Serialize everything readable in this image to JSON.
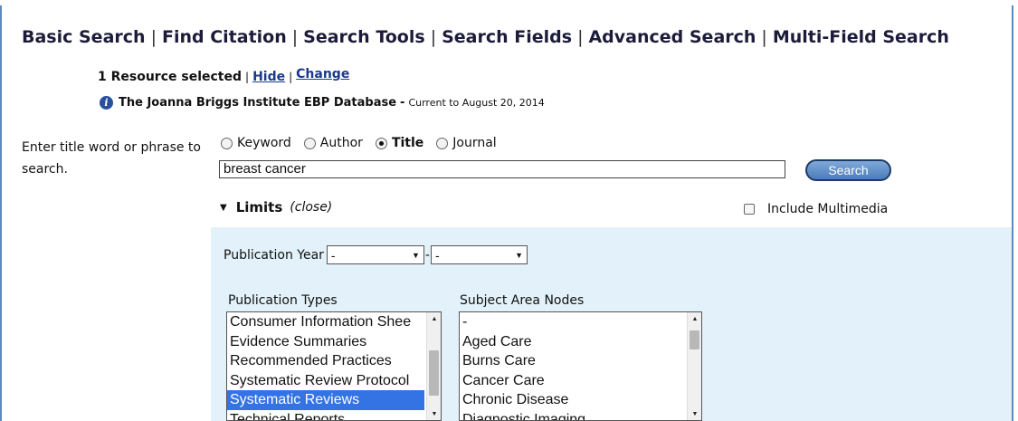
{
  "nav": {
    "items": [
      "Basic Search",
      "Find Citation",
      "Search Tools",
      "Search Fields",
      "Advanced Search",
      "Multi-Field Search"
    ],
    "separator": "|"
  },
  "resources": {
    "selected_text": "1 Resource selected",
    "pipe": "|",
    "hide_label": "Hide",
    "change_label": "Change",
    "database_name": "The Joanna Briggs Institute EBP Database",
    "dash": "-",
    "current_text": "Current to August 20, 2014"
  },
  "search": {
    "prompt": "Enter title word or phrase to search.",
    "field_options": [
      {
        "label": "Keyword",
        "checked": false
      },
      {
        "label": "Author",
        "checked": false
      },
      {
        "label": "Title",
        "checked": true
      },
      {
        "label": "Journal",
        "checked": false
      }
    ],
    "query": "breast cancer",
    "button_label": "Search"
  },
  "limits": {
    "label": "Limits",
    "close_label": "(close)",
    "include_multimedia_label": "Include Multimedia",
    "include_multimedia_checked": false,
    "publication_year_label": "Publication Year",
    "year_from": "-",
    "year_to": "-",
    "year_separator": "-",
    "publication_types_label": "Publication Types",
    "publication_types": [
      {
        "label": "Consumer Information Shee",
        "selected": false
      },
      {
        "label": "Evidence Summaries",
        "selected": false
      },
      {
        "label": "Recommended Practices",
        "selected": false
      },
      {
        "label": "Systematic Review Protocol",
        "selected": false
      },
      {
        "label": "Systematic Reviews",
        "selected": true
      },
      {
        "label": "Technical Reports",
        "selected": false
      }
    ],
    "subject_area_label": "Subject Area Nodes",
    "subject_areas": [
      {
        "label": "-",
        "selected": false
      },
      {
        "label": "Aged Care",
        "selected": false
      },
      {
        "label": "Burns Care",
        "selected": false
      },
      {
        "label": "Cancer Care",
        "selected": false
      },
      {
        "label": "Chronic Disease",
        "selected": false
      },
      {
        "label": "Diagnostic Imaging",
        "selected": false
      }
    ]
  },
  "colors": {
    "accent": "#5b8bbf",
    "panel": "#e3f2fa",
    "selected_option": "#3373e4",
    "link": "#1b3a8c"
  }
}
